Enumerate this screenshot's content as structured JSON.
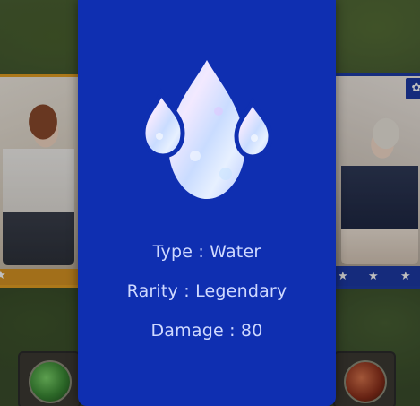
{
  "modal": {
    "element_icon": "water-drops-icon",
    "accent_color": "#0f2fb1",
    "text_color": "#cfd9ff",
    "stats": {
      "type": "Type : Water",
      "rarity": "Rarity : Legendary",
      "damage": "Damage : 80"
    }
  },
  "background": {
    "left_card_border_color": "#e6a023",
    "right_card_border_color": "#1e3da8"
  }
}
